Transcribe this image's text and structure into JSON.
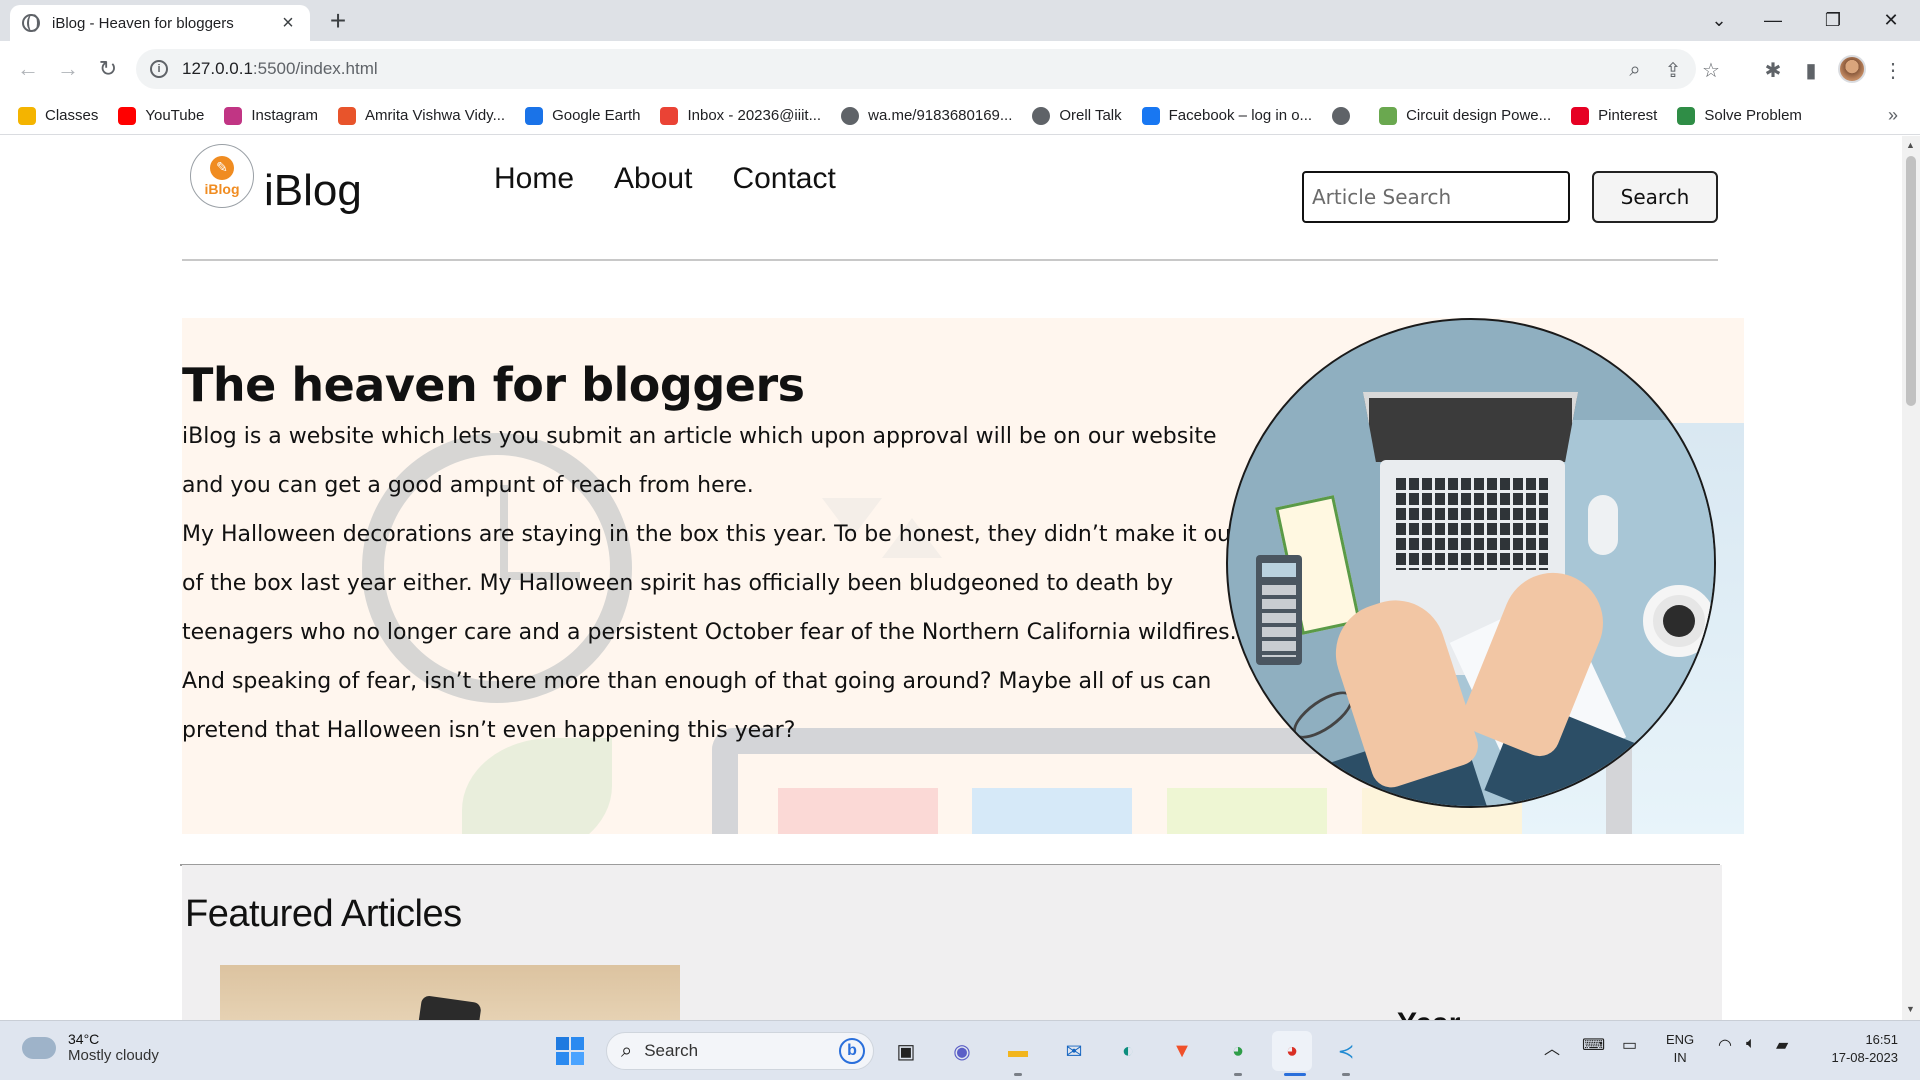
{
  "browser": {
    "tab_title": "iBlog - Heaven for bloggers",
    "tab_close": "×",
    "new_tab": "+",
    "url_host": "127.0.0.1",
    "url_path": ":5500/index.html",
    "window_controls": {
      "list": "⌄",
      "minimize": "—",
      "maximize": "❐",
      "close": "✕"
    },
    "nav": {
      "back": "←",
      "forward": "→",
      "reload": "↻"
    },
    "bookmarks": [
      {
        "label": "Classes",
        "icon": "classroom-icon",
        "color": "#f4b400"
      },
      {
        "label": "YouTube",
        "icon": "youtube-icon",
        "color": "#ff0000"
      },
      {
        "label": "Instagram",
        "icon": "instagram-icon",
        "color": "#c13584"
      },
      {
        "label": "Amrita Vishwa Vidy...",
        "icon": "amrita-icon",
        "color": "#e8542b"
      },
      {
        "label": "Google Earth",
        "icon": "google-earth-icon",
        "color": "#1a73e8"
      },
      {
        "label": "Inbox  - 20236@iiit...",
        "icon": "gmail-icon",
        "color": "#ea4335"
      },
      {
        "label": "wa.me/9183680169...",
        "icon": "globe-icon",
        "color": "#5f6368"
      },
      {
        "label": "Orell Talk",
        "icon": "globe-icon",
        "color": "#5f6368"
      },
      {
        "label": "Facebook – log in o...",
        "icon": "facebook-icon",
        "color": "#1877f2"
      },
      {
        "label": "",
        "icon": "globe-icon",
        "color": "#5f6368"
      },
      {
        "label": "Circuit design Powe...",
        "icon": "circuit-icon",
        "color": "#6aa84f"
      },
      {
        "label": "Pinterest",
        "icon": "pinterest-icon",
        "color": "#e60023"
      },
      {
        "label": "Solve Problem",
        "icon": "geeksforgeeks-icon",
        "color": "#2f8d46"
      }
    ],
    "bookmarks_more": "»"
  },
  "site": {
    "logo_text": "iBlog",
    "brand": "iBlog",
    "nav_links": [
      "Home",
      "About",
      "Contact"
    ],
    "search_placeholder": "Article Search",
    "search_button": "Search",
    "hero_title": "The heaven for bloggers",
    "hero_paragraph_1": "iBlog is a website which lets you submit an article which upon approval will be on our website and you can get a good ampunt of reach from here.",
    "hero_paragraph_2": "My Halloween decorations are staying in the box this year. To be honest, they didn’t make it out of the box last year either. My Halloween spirit has officially been bludgeoned to death by teenagers who no longer care and a persistent October fear of the Northern California wildfires. And speaking of fear, isn’t there more than enough of that going around? Maybe all of us can pretend that Halloween isn’t even happening this year?",
    "featured_title": "Featured Articles",
    "featured_year_partial": "Year"
  },
  "taskbar": {
    "temperature": "34°C",
    "weather": "Mostly cloudy",
    "search_label": "Search",
    "lang_1": "ENG",
    "lang_2": "IN",
    "time": "16:51",
    "date": "17-08-2023"
  }
}
